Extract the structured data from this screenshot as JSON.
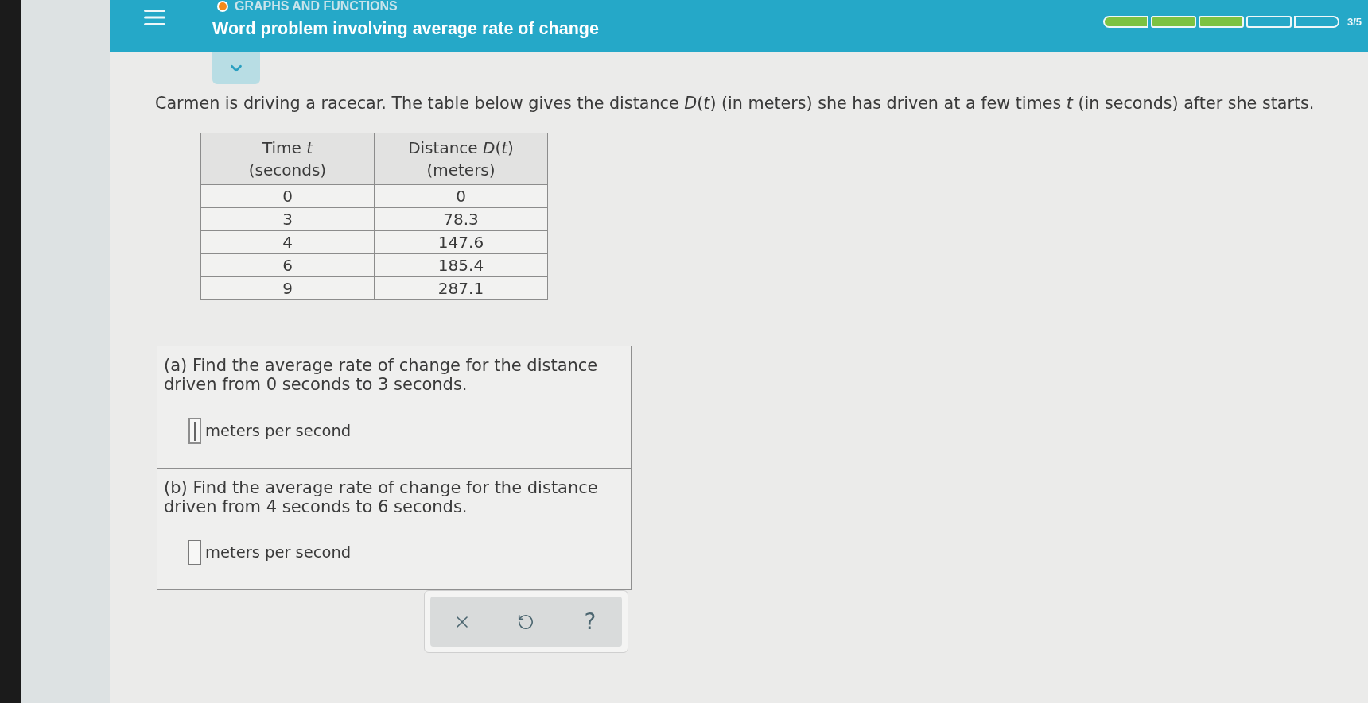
{
  "header": {
    "category": "GRAPHS AND FUNCTIONS",
    "title": "Word problem involving average rate of change",
    "progress": {
      "segments": [
        {
          "filled": true
        },
        {
          "filled": true
        },
        {
          "filled": true
        },
        {
          "filled": false
        },
        {
          "filled": false
        }
      ],
      "label": "3/5"
    }
  },
  "problem": {
    "text": "Carmen is driving a racecar. The table below gives the distance *D*(*t*) (in meters) she has driven at a few times *t* (in seconds) after she starts."
  },
  "table": {
    "columns": [
      {
        "label": "Time *t*",
        "unit": "(seconds)"
      },
      {
        "label": "Distance *D*(*t*)",
        "unit": "(meters)"
      }
    ],
    "rows": [
      [
        "0",
        "0"
      ],
      [
        "3",
        "78.3"
      ],
      [
        "4",
        "147.6"
      ],
      [
        "6",
        "185.4"
      ],
      [
        "9",
        "287.1"
      ]
    ]
  },
  "parts": [
    {
      "prompt": "(a) Find the average rate of change for the distance driven from 0 seconds to 3 seconds.",
      "unit": "meters per second",
      "focused": true
    },
    {
      "prompt": "(b) Find the average rate of change for the distance driven from 4 seconds to 6 seconds.",
      "unit": "meters per second",
      "focused": false
    }
  ],
  "tools": [
    {
      "kind": "clear"
    },
    {
      "kind": "undo"
    },
    {
      "kind": "help",
      "symbol": "?"
    }
  ]
}
